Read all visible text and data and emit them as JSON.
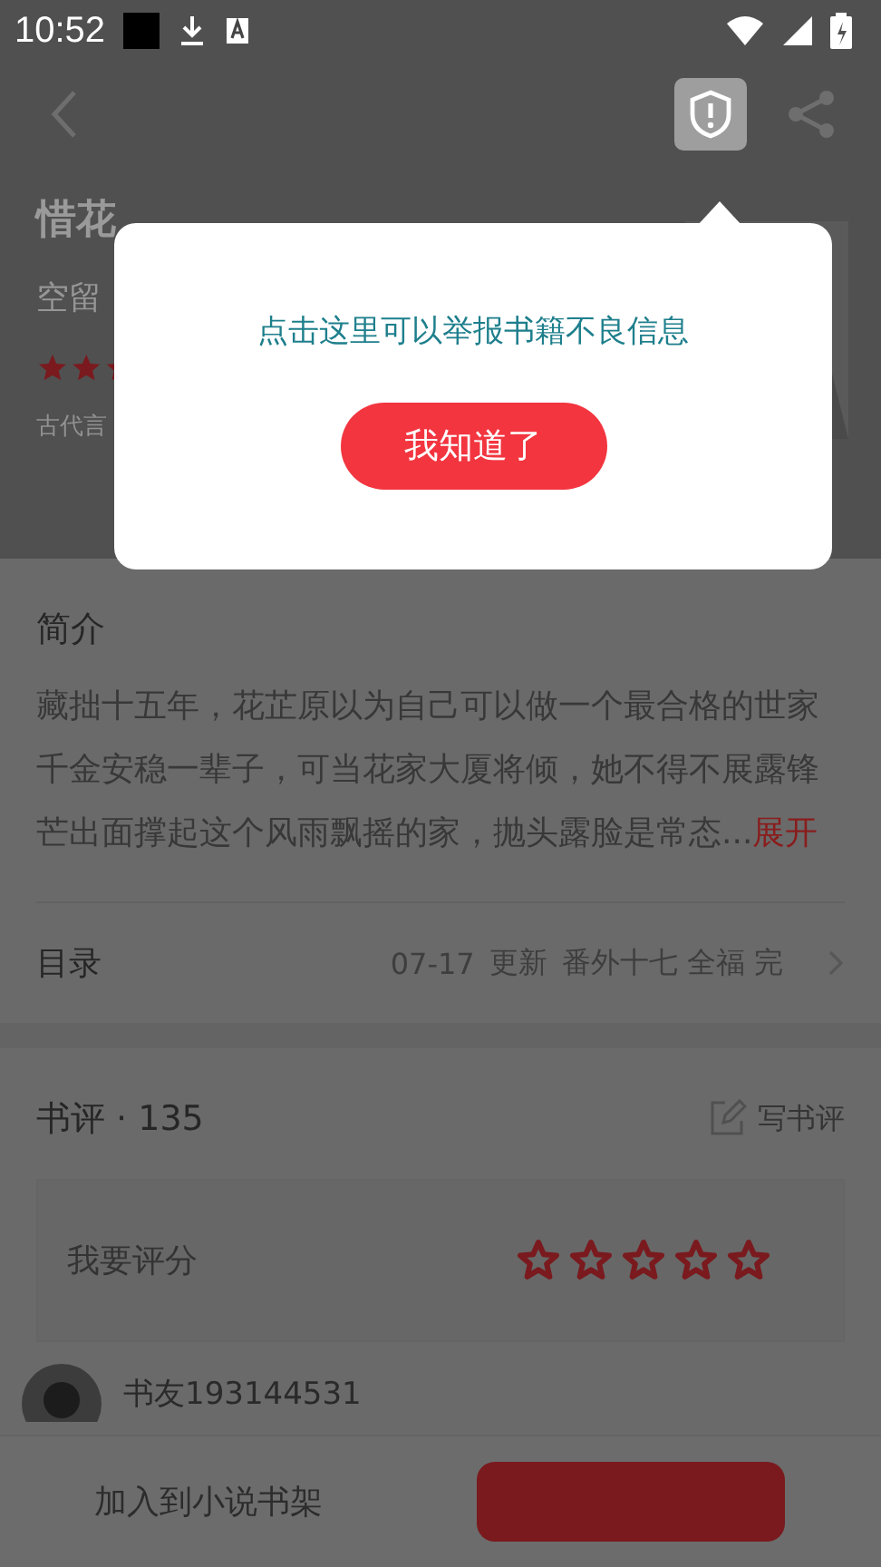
{
  "status_bar": {
    "time": "10:52"
  },
  "book": {
    "title": "惜花",
    "author": "空留",
    "category": "古代言"
  },
  "popup": {
    "message": "点击这里可以举报书籍不良信息",
    "button": "我知道了"
  },
  "intro": {
    "heading": "简介",
    "text": "藏拙十五年，花芷原以为自己可以做一个最合格的世家千金安稳一辈子，可当花家大厦将倾，她不得不展露锋芒出面撑起这个风雨飘摇的家，抛头露脸是常态...",
    "more": "展开"
  },
  "catalog": {
    "label": "目录",
    "date": "07-17",
    "update": "更新",
    "latest": "番外十七 全福 完"
  },
  "reviews": {
    "heading": "书评 · 135",
    "write": "写书评",
    "rate_label": "我要评分",
    "stars": 0,
    "first_user": "书友193144531"
  },
  "bottom_bar": {
    "shelf": "加入到小说书架"
  }
}
